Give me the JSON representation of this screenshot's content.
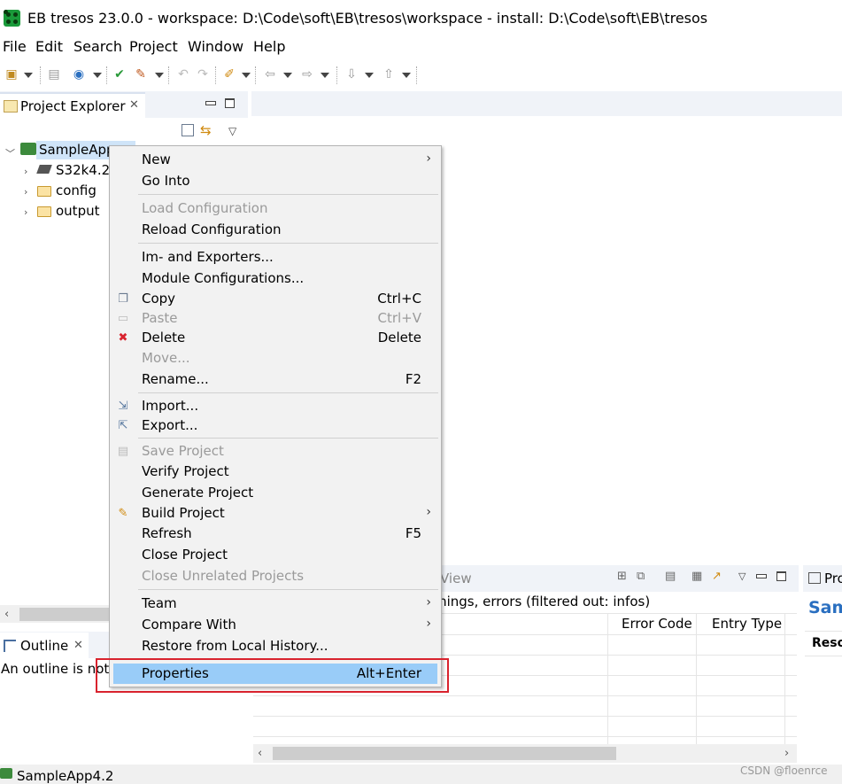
{
  "window": {
    "title": "EB tresos 23.0.0 - workspace: D:\\Code\\soft\\EB\\tresos\\workspace - install: D:\\Code\\soft\\EB\\tresos"
  },
  "menubar": [
    "File",
    "Edit",
    "Search",
    "Project",
    "Window",
    "Help"
  ],
  "toolbar": {
    "icons": [
      "new-wizard-icon",
      "save-icon",
      "globe-icon",
      "check-project-icon",
      "undo-icon",
      "redo-icon",
      "pin-icon",
      "back-icon",
      "forward-icon",
      "next-annotation-icon",
      "prev-annotation-icon"
    ]
  },
  "project_explorer": {
    "title": "Project Explorer",
    "tree": [
      {
        "label": "SampleApp",
        "level": 0,
        "expanded": true
      },
      {
        "label": "S32k4.2",
        "level": 1
      },
      {
        "label": "config",
        "level": 1
      },
      {
        "label": "output",
        "level": 1
      }
    ]
  },
  "outline": {
    "title": "Outline",
    "body": "An outline is not"
  },
  "problems_view": {
    "title_fragment": "View",
    "filter_text": "arnings, errors (filtered out: infos)",
    "columns": [
      "Error Code",
      "Entry Type"
    ]
  },
  "properties_view": {
    "title_fragment": "Pro",
    "heading_fragment": "Sam",
    "column_fragment": "Reso"
  },
  "context_menu": {
    "items": [
      {
        "label": "New",
        "submenu": true
      },
      {
        "label": "Go Into"
      },
      {
        "label": "Load Configuration",
        "disabled": true
      },
      {
        "label": "Reload Configuration"
      },
      {
        "label": "Im- and Exporters..."
      },
      {
        "label": "Module Configurations..."
      },
      {
        "label": "Copy",
        "shortcut": "Ctrl+C",
        "icon": "copy-icon"
      },
      {
        "label": "Paste",
        "shortcut": "Ctrl+V",
        "disabled": true,
        "icon": "paste-icon"
      },
      {
        "label": "Delete",
        "shortcut": "Delete",
        "icon": "delete-icon"
      },
      {
        "label": "Move...",
        "disabled": true
      },
      {
        "label": "Rename...",
        "shortcut": "F2"
      },
      {
        "label": "Import...",
        "icon": "import-icon"
      },
      {
        "label": "Export...",
        "icon": "export-icon"
      },
      {
        "label": "Save Project",
        "disabled": true,
        "icon": "save-project-icon"
      },
      {
        "label": "Verify Project"
      },
      {
        "label": "Generate Project"
      },
      {
        "label": "Build Project",
        "submenu": true,
        "icon": "build-icon"
      },
      {
        "label": "Refresh",
        "shortcut": "F5"
      },
      {
        "label": "Close Project"
      },
      {
        "label": "Close Unrelated Projects",
        "disabled": true
      },
      {
        "label": "Team",
        "submenu": true
      },
      {
        "label": "Compare With",
        "submenu": true
      },
      {
        "label": "Restore from Local History..."
      },
      {
        "label": "Properties",
        "shortcut": "Alt+Enter",
        "selected": true
      }
    ]
  },
  "statusbar": {
    "text": "SampleApp4.2"
  },
  "watermark": "CSDN @floenrce",
  "colors": {
    "selection": "#99ccf8",
    "highlight_box": "#d9232e",
    "delete_icon": "#d9232e"
  }
}
